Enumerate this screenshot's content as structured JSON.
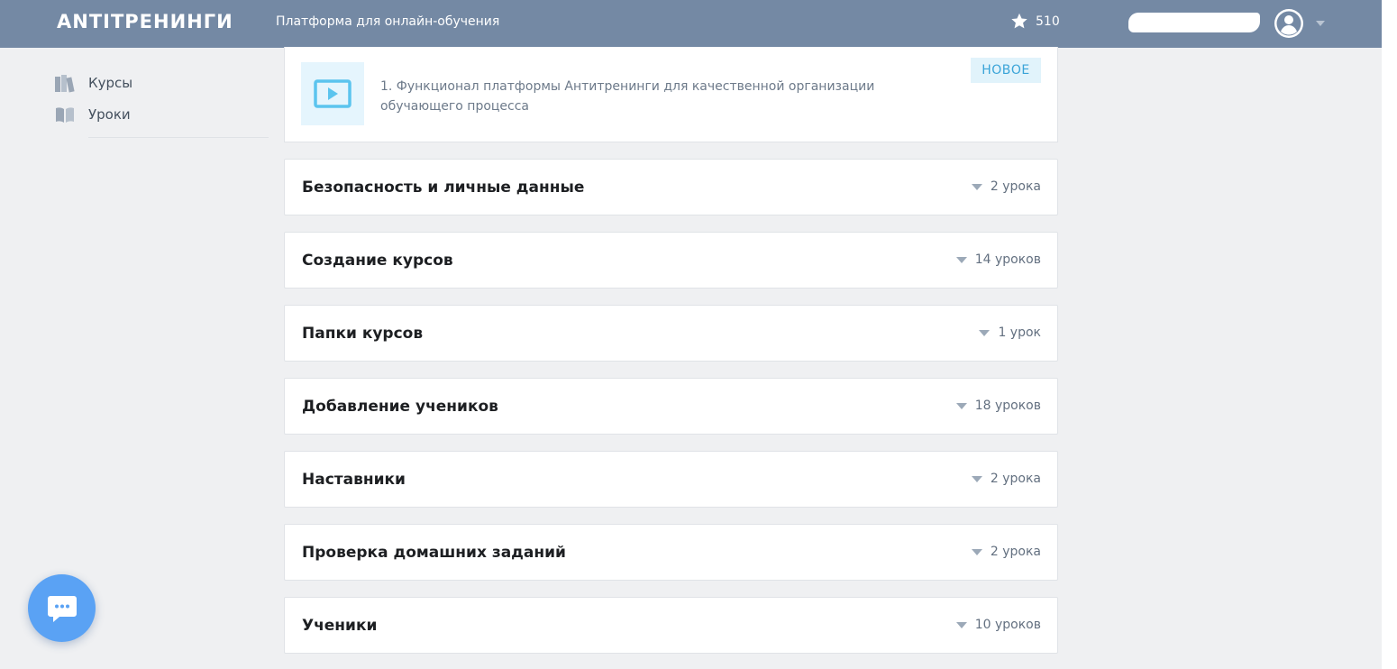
{
  "header": {
    "logo": "ANTIТРЕНИНГИ",
    "tagline": "Платформа для онлайн-обучения",
    "points": "510"
  },
  "sidebar": {
    "items": [
      {
        "label": "Курсы",
        "icon": "books-icon"
      },
      {
        "label": "Уроки",
        "icon": "open-book-icon"
      }
    ]
  },
  "lesson": {
    "title": "1. Функционал платформы Антитренинги для качественной организации обучающего процесса",
    "badge": "НОВОЕ",
    "icon": "video-play-icon"
  },
  "sections": [
    {
      "title": "Безопасность и личные данные",
      "count": "2 урока"
    },
    {
      "title": "Создание курсов",
      "count": "14 уроков"
    },
    {
      "title": "Папки курсов",
      "count": "1 урок"
    },
    {
      "title": "Добавление учеников",
      "count": "18 уроков"
    },
    {
      "title": "Наставники",
      "count": "2 урока"
    },
    {
      "title": "Проверка домашних заданий",
      "count": "2 урока"
    },
    {
      "title": "Ученики",
      "count": "10 уроков"
    }
  ],
  "colors": {
    "header_bg": "#7489a4",
    "page_bg": "#eff0f2",
    "badge_text": "#3aa4d8",
    "chat_button": "#5aa2f4"
  }
}
